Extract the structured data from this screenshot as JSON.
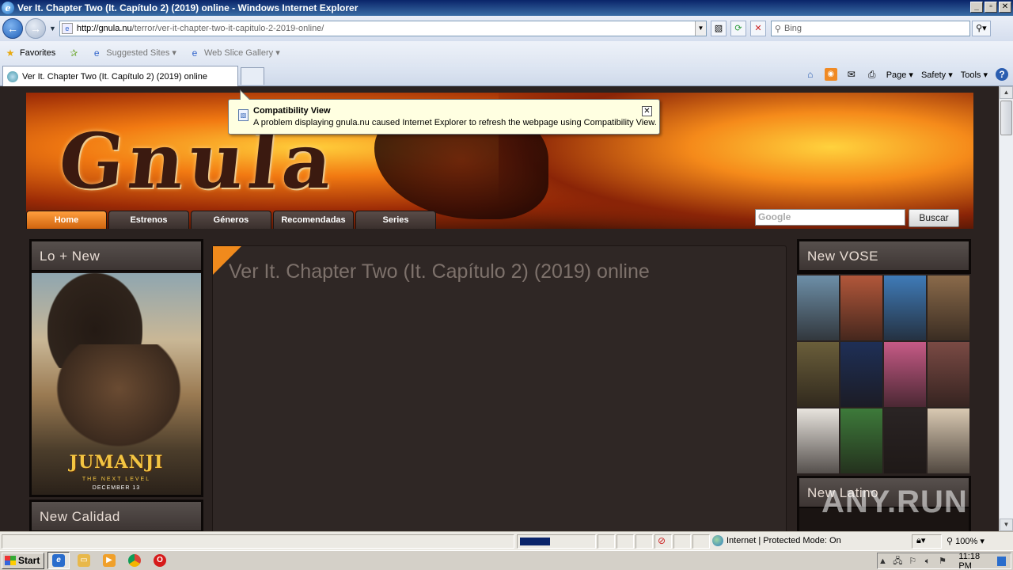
{
  "window": {
    "title": "Ver It. Chapter Two (It. Capítulo 2) (2019) online - Windows Internet Explorer",
    "min_glyph": "_",
    "max_glyph": "▫",
    "close_glyph": "✕"
  },
  "addressbar": {
    "url_host": "http://gnula.nu",
    "url_path": "/terror/ver-it-chapter-two-it-capitulo-2-2019-online/",
    "search_placeholder": "Bing",
    "back_glyph": "←",
    "forward_glyph": "→"
  },
  "favorites_bar": {
    "favorites_label": "Favorites",
    "items": [
      {
        "label": "Suggested Sites ▾"
      },
      {
        "label": "Web Slice Gallery ▾"
      }
    ]
  },
  "tabs": [
    {
      "label": "Ver It. Chapter Two (It. Capítulo 2) (2019) online",
      "active": true
    }
  ],
  "command_bar": {
    "page_label": "Page ▾",
    "safety_label": "Safety ▾",
    "tools_label": "Tools ▾",
    "help_glyph": "?"
  },
  "compat_popup": {
    "title": "Compatibility View",
    "message": "A problem displaying gnula.nu caused Internet Explorer to refresh the webpage using Compatibility View.",
    "close_glyph": "✕"
  },
  "site": {
    "logo_text": "Gnula",
    "nav": [
      {
        "label": "Home",
        "active": true
      },
      {
        "label": "Estrenos"
      },
      {
        "label": "Géneros"
      },
      {
        "label": "Recomendadas"
      },
      {
        "label": "Series"
      }
    ],
    "search_placeholder": "Google",
    "search_button": "Buscar"
  },
  "left_sidebar": {
    "box1_title": "Lo + New",
    "poster_title": "JUMANJI",
    "poster_subtitle": "THE NEXT LEVEL",
    "poster_date": "DECEMBER 13",
    "box2_title": "New Calidad"
  },
  "main": {
    "heading": "Ver It. Chapter Two (It. Capítulo 2) (2019) online"
  },
  "right_sidebar": {
    "box1_title": "New VOSE",
    "posters": [
      {
        "color": "#6d8fa8"
      },
      {
        "color": "#b2573a"
      },
      {
        "color": "#3f7bb8"
      },
      {
        "color": "#8a6a4a"
      },
      {
        "color": "#6a5e3a"
      },
      {
        "color": "#1e2f56"
      },
      {
        "color": "#c65a86"
      },
      {
        "color": "#7a4a44"
      },
      {
        "color": "#e8e4de"
      },
      {
        "color": "#3d7a3a"
      },
      {
        "color": "#2a2424"
      },
      {
        "color": "#d9c9b2"
      }
    ],
    "box2_title": "New Latino"
  },
  "statusbar": {
    "zone": "Internet | Protected Mode: On",
    "zoom": "100%  ▾"
  },
  "taskbar": {
    "start_label": "Start",
    "clock": "11:18 PM"
  },
  "watermark": "ANY.RUN"
}
